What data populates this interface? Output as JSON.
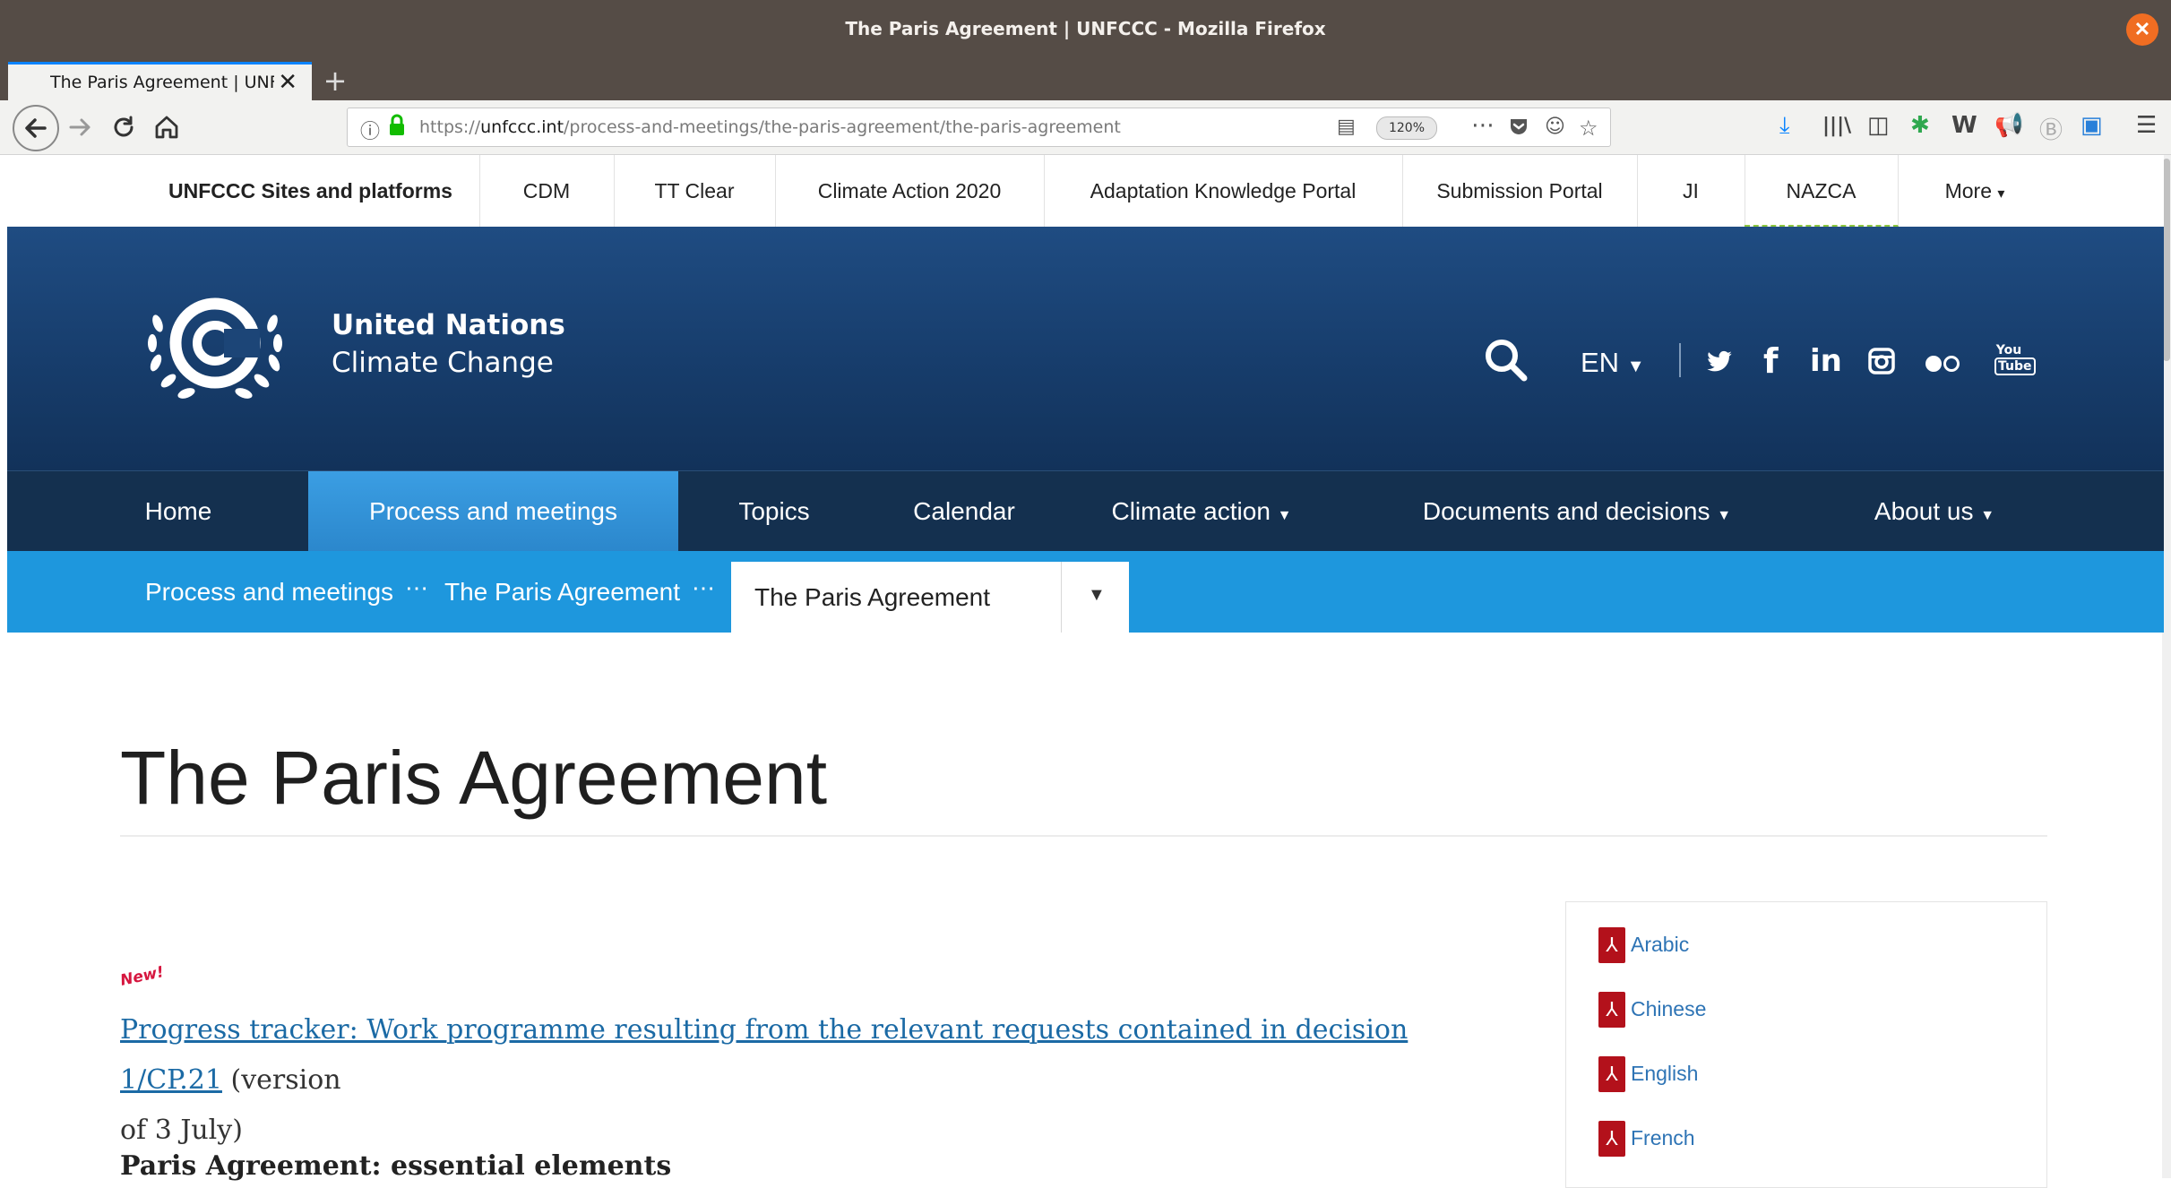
{
  "browser": {
    "window_title": "The Paris Agreement | UNFCCC - Mozilla Firefox",
    "tab_title": "The Paris Agreement | UNFCCC",
    "url_prefix": "https://",
    "url_host": "unfccc.int",
    "url_path": "/process-and-meetings/the-paris-agreement/the-paris-agreement",
    "zoom": "120%"
  },
  "sites_bar": {
    "label": "UNFCCC Sites and platforms",
    "links": [
      "CDM",
      "TT Clear",
      "Climate Action 2020",
      "Adaptation Knowledge Portal",
      "Submission Portal",
      "JI",
      "NAZCA"
    ],
    "more": "More"
  },
  "header": {
    "org_line1": "United Nations",
    "org_line2": "Climate Change",
    "language": "EN",
    "social": [
      "twitter",
      "facebook",
      "linkedin",
      "instagram",
      "flickr",
      "youtube"
    ]
  },
  "main_nav": {
    "items": [
      "Home",
      "Process and meetings",
      "Topics",
      "Calendar",
      "Climate action",
      "Documents and decisions",
      "About us"
    ],
    "active": "Process and meetings"
  },
  "breadcrumb": {
    "items": [
      "Process and meetings",
      "The Paris Agreement"
    ],
    "select_value": "The Paris Agreement"
  },
  "content": {
    "title": "The Paris Agreement",
    "new_badge": "New!",
    "tracker_link": "Progress tracker: Work programme resulting from the relevant requests contained in decision 1/CP.21",
    "tracker_suffix": " (version",
    "tracker_line2": "of 3 July)",
    "section_heading": "Paris Agreement: essential elements"
  },
  "sidebar": {
    "languages": [
      "Arabic",
      "Chinese",
      "English",
      "French"
    ]
  },
  "colors": {
    "header_blue": "#1a4475",
    "nav_dark": "#14304f",
    "active_tab": "#3a9be0",
    "breadcrumb_blue": "#1e97dd",
    "link_blue": "#2e74b5",
    "pdf_red": "#b3111b"
  }
}
